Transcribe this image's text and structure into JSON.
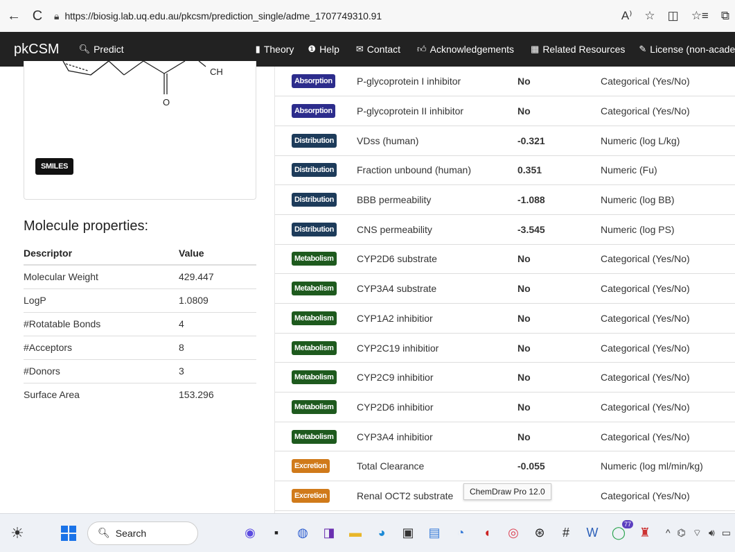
{
  "browser": {
    "url": "https://biosig.lab.uq.edu.au/pkcsm/prediction_single/adme_1707749310.91",
    "back_icon": "←",
    "refresh_icon": "C",
    "read_aloud_icon": "A⁾",
    "favorite_icon": "☆",
    "split_icon": "◫",
    "favorites_list_icon": "☆≡",
    "collections_icon": "⧉"
  },
  "navbar": {
    "brand": "pkCSM",
    "predict": "Predict",
    "theory": "Theory",
    "help": "Help",
    "contact": "Contact",
    "acknowledgements": "Acknowledgements",
    "related": "Related Resources",
    "license": "License (non-acader"
  },
  "molecule": {
    "atom_o": "O",
    "atom_ch": "CH",
    "smiles_label": "SMILES"
  },
  "molecule_properties": {
    "title": "Molecule properties:",
    "headers": {
      "descriptor": "Descriptor",
      "value": "Value"
    },
    "rows": [
      {
        "descriptor": "Molecular Weight",
        "value": "429.447"
      },
      {
        "descriptor": "LogP",
        "value": "1.0809"
      },
      {
        "descriptor": "#Rotatable Bonds",
        "value": "4"
      },
      {
        "descriptor": "#Acceptors",
        "value": "8"
      },
      {
        "descriptor": "#Donors",
        "value": "3"
      },
      {
        "descriptor": "Surface Area",
        "value": "153.296"
      }
    ]
  },
  "colors": {
    "absorption": "#2c2c8c",
    "distribution": "#1d3b5a",
    "metabolism": "#1e5a1e",
    "excretion": "#d07a1a"
  },
  "predictions": [
    {
      "category": "Absorption",
      "color_key": "absorption",
      "property": "P-glycoprotein I inhibitor",
      "value": "No",
      "unit": "Categorical (Yes/No)"
    },
    {
      "category": "Absorption",
      "color_key": "absorption",
      "property": "P-glycoprotein II inhibitor",
      "value": "No",
      "unit": "Categorical (Yes/No)"
    },
    {
      "category": "Distribution",
      "color_key": "distribution",
      "property": "VDss (human)",
      "value": "-0.321",
      "unit": "Numeric (log L/kg)"
    },
    {
      "category": "Distribution",
      "color_key": "distribution",
      "property": "Fraction unbound (human)",
      "value": "0.351",
      "unit": "Numeric (Fu)"
    },
    {
      "category": "Distribution",
      "color_key": "distribution",
      "property": "BBB permeability",
      "value": "-1.088",
      "unit": "Numeric (log BB)"
    },
    {
      "category": "Distribution",
      "color_key": "distribution",
      "property": "CNS permeability",
      "value": "-3.545",
      "unit": "Numeric (log PS)"
    },
    {
      "category": "Metabolism",
      "color_key": "metabolism",
      "property": "CYP2D6 substrate",
      "value": "No",
      "unit": "Categorical (Yes/No)"
    },
    {
      "category": "Metabolism",
      "color_key": "metabolism",
      "property": "CYP3A4 substrate",
      "value": "No",
      "unit": "Categorical (Yes/No)"
    },
    {
      "category": "Metabolism",
      "color_key": "metabolism",
      "property": "CYP1A2 inhibitior",
      "value": "No",
      "unit": "Categorical (Yes/No)"
    },
    {
      "category": "Metabolism",
      "color_key": "metabolism",
      "property": "CYP2C19 inhibitior",
      "value": "No",
      "unit": "Categorical (Yes/No)"
    },
    {
      "category": "Metabolism",
      "color_key": "metabolism",
      "property": "CYP2C9 inhibitior",
      "value": "No",
      "unit": "Categorical (Yes/No)"
    },
    {
      "category": "Metabolism",
      "color_key": "metabolism",
      "property": "CYP2D6 inhibitior",
      "value": "No",
      "unit": "Categorical (Yes/No)"
    },
    {
      "category": "Metabolism",
      "color_key": "metabolism",
      "property": "CYP3A4 inhibitior",
      "value": "No",
      "unit": "Categorical (Yes/No)"
    },
    {
      "category": "Excretion",
      "color_key": "excretion",
      "property": "Total Clearance",
      "value": "-0.055",
      "unit": "Numeric (log ml/min/kg)"
    },
    {
      "category": "Excretion",
      "color_key": "excretion",
      "property": "Renal OCT2 substrate",
      "value": "",
      "unit": "Categorical (Yes/No)"
    }
  ],
  "tooltip": "ChemDraw Pro 12.0",
  "taskbar": {
    "search_label": "Search",
    "notification_count": "77",
    "icons": [
      "copilot-icon",
      "file-explorer-icon",
      "chat-icon",
      "vs-icon",
      "folder-icon",
      "edge-icon",
      "store-icon",
      "mhp-icon",
      "chrome-icon",
      "mcafee-icon",
      "paint-icon",
      "chatgpt-icon",
      "hash-icon",
      "word-icon",
      "whatsapp-icon",
      "babel-icon"
    ]
  }
}
